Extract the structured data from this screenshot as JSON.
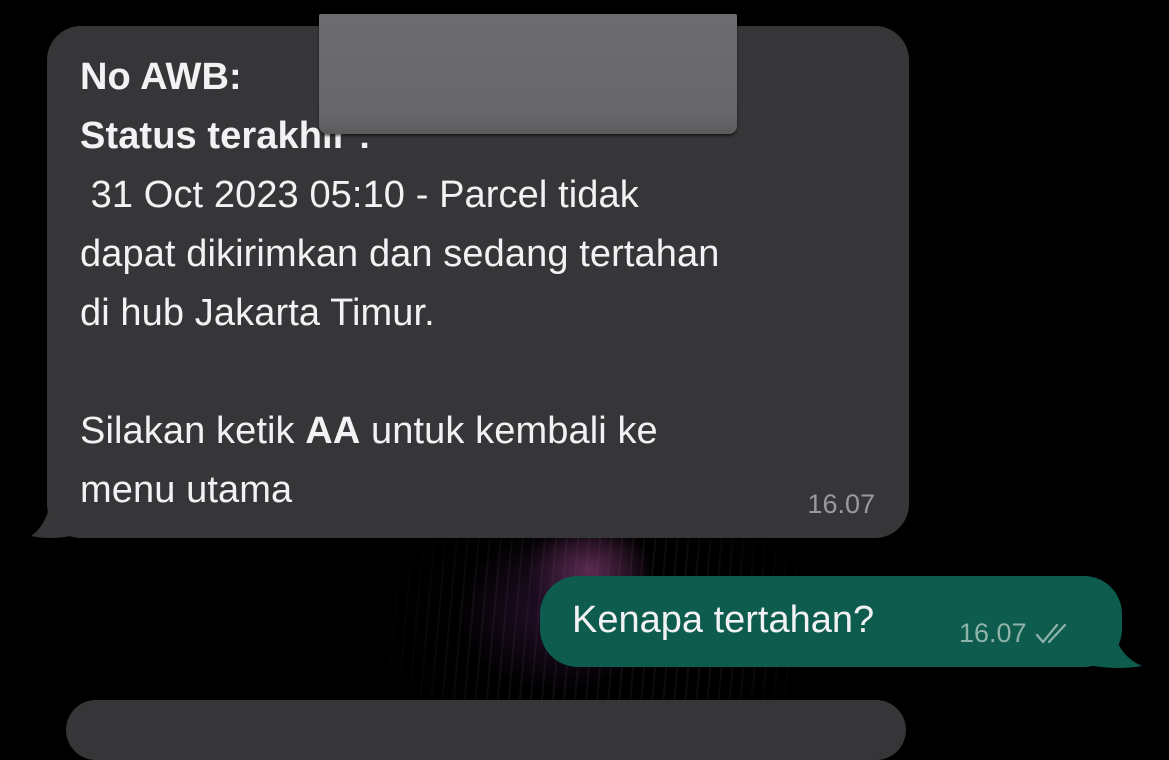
{
  "chat": {
    "incoming": {
      "awb_label": "No AWB:",
      "status_label": "Status terakhir :",
      "status_line1": " 31 Oct 2023 05:10 - Parcel tidak",
      "status_line2": "dapat dikirimkan dan sedang tertahan",
      "status_line3": "di hub Jakarta Timur.",
      "instruction_prefix": "Silakan ketik ",
      "instruction_keyword": "AA",
      "instruction_suffix": " untuk kembali ke",
      "instruction_line2": "menu utama",
      "time": "16.07"
    },
    "outgoing": {
      "text": "Kenapa tertahan?",
      "time": "16.07",
      "status_icon": "double-check-icon"
    }
  },
  "colors": {
    "background": "#000000",
    "incoming_bubble": "#363638",
    "outgoing_bubble": "#0d5c4d",
    "text": "#f2f2f4",
    "incoming_time": "#9a9a9e",
    "outgoing_time": "#8fb3aa"
  }
}
